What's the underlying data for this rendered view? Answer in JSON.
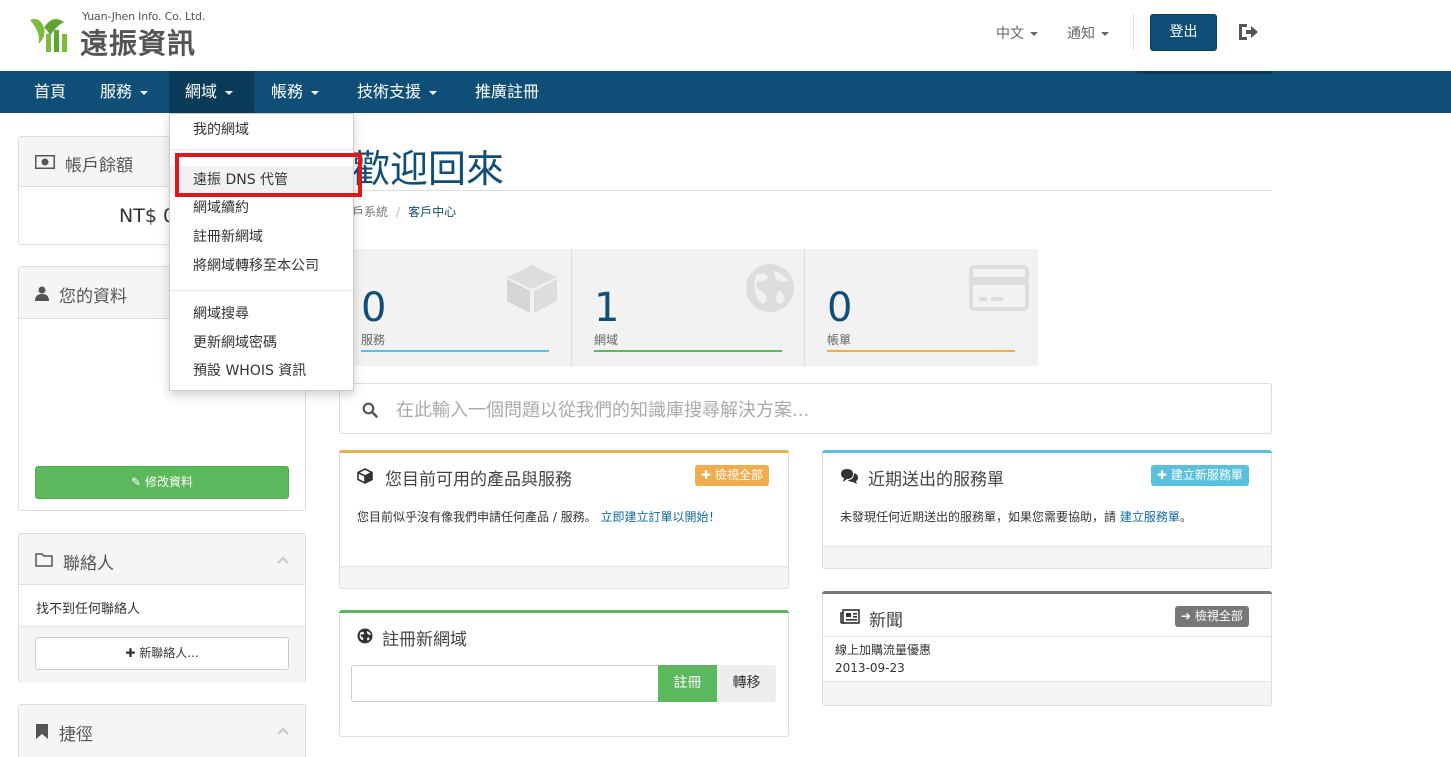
{
  "header": {
    "logo_small": "Yuan-Jhen Info. Co. Ltd.",
    "logo_main": "遠振資訊",
    "language": "中文",
    "notifications": "通知",
    "logout": "登出"
  },
  "nav": {
    "items": [
      "首頁",
      "服務",
      "網域",
      "帳務",
      "技術支援",
      "推廣註冊"
    ]
  },
  "dropdown": {
    "group1": [
      "我的網域",
      "遠振 DNS 代管",
      "網域續約",
      "註冊新網域",
      "將網域轉移至本公司"
    ],
    "group2": [
      "網域搜尋",
      "更新網域密碼",
      "預設 WHOIS 資訊"
    ]
  },
  "sidebar": {
    "balance": {
      "title": "帳戶餘額",
      "amount": "NT$ 0"
    },
    "profile": {
      "title": "您的資料",
      "edit_button": "修改資料"
    },
    "contacts": {
      "title": "聯絡人",
      "empty": "找不到任何聯絡人",
      "new_button": "新聯絡人..."
    },
    "shortcuts": {
      "title": "捷徑"
    }
  },
  "main": {
    "title": "歡迎回來",
    "breadcrumb": [
      "戶系統",
      "客戶中心"
    ],
    "tiles": [
      {
        "value": "0",
        "label": "服務",
        "color": "#5bc0de"
      },
      {
        "value": "1",
        "label": "網域",
        "color": "#5cb85c"
      },
      {
        "value": "0",
        "label": "帳單",
        "color": "#f0ad4e"
      }
    ],
    "search_placeholder": "在此輸入一個問題以從我們的知識庫搜尋解決方案...",
    "products": {
      "title": "您目前可用的產品與服務",
      "button": "檢視全部",
      "text": "您目前似乎沒有像我們申請任何產品 / 服務。",
      "link": "立即建立訂單以開始！"
    },
    "tickets": {
      "title": "近期送出的服務單",
      "button": "建立新服務單",
      "text": "未發現任何近期送出的服務單，如果您需要協助，請",
      "link": "建立服務單",
      "end": "。"
    },
    "register": {
      "title": "註冊新網域",
      "register_button": "註冊",
      "transfer_button": "轉移"
    },
    "news": {
      "title": "新聞",
      "button": "檢視全部",
      "item_title": "線上加購流量優惠",
      "item_date": "2013-09-23"
    }
  },
  "colors": {
    "brand": "#0f4f77",
    "highlight_box": "#e0161b"
  }
}
